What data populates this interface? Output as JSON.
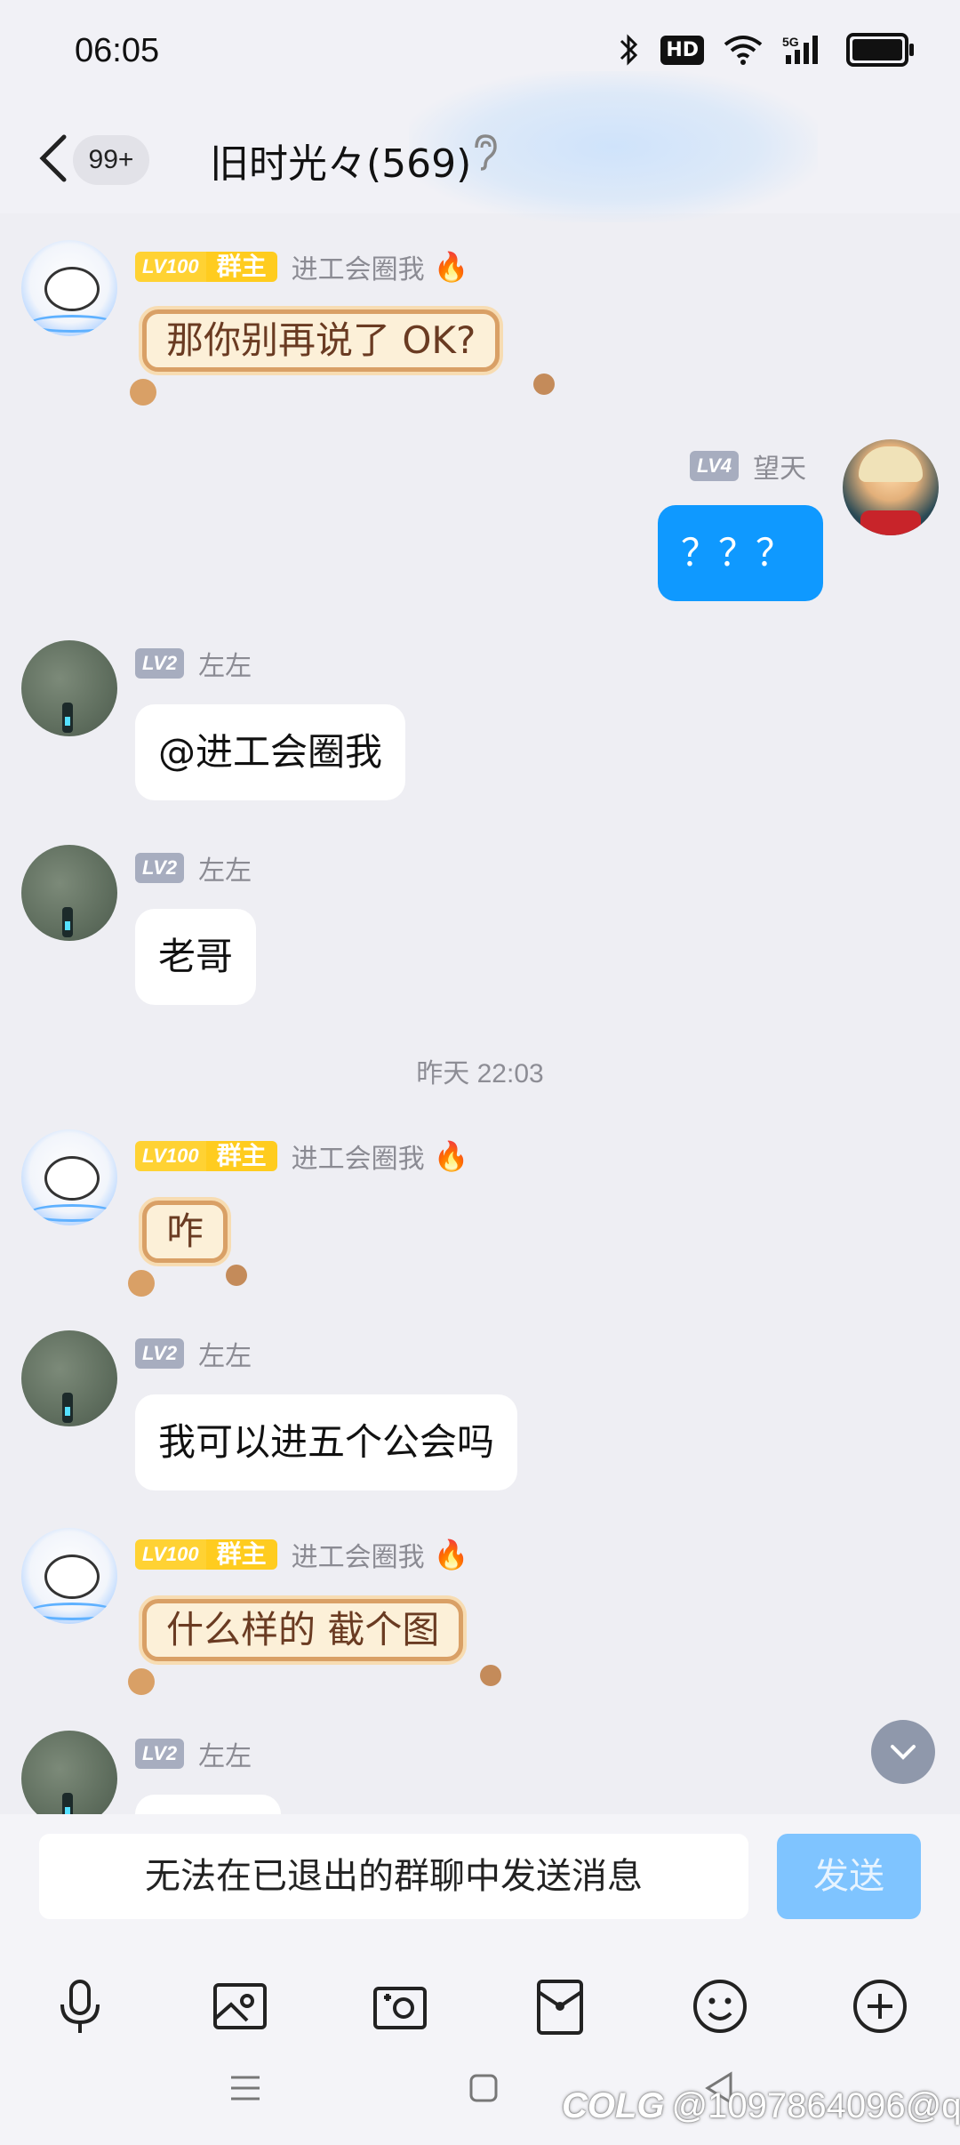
{
  "status_bar": {
    "time": "06:05",
    "hd": "HD",
    "network": "5G"
  },
  "header": {
    "unread_badge": "99+",
    "title": "旧时光々(569)",
    "back_icon": "chevron-left-icon",
    "ear_icon": "ear-icon"
  },
  "messages": [
    {
      "sender": "进工会圈我",
      "level": "LV100",
      "role": "群主",
      "text": "那你别再说了 OK?"
    },
    {
      "sender": "望天",
      "level": "LV4",
      "text": "？？？"
    },
    {
      "sender": "左左",
      "level": "LV2",
      "text": "@进工会圈我"
    },
    {
      "sender": "左左",
      "level": "LV2",
      "text": "老哥"
    },
    {
      "timestamp": "昨天 22:03"
    },
    {
      "sender": "进工会圈我",
      "level": "LV100",
      "role": "群主",
      "text": "咋"
    },
    {
      "sender": "左左",
      "level": "LV2",
      "text": "我可以进五个公会吗"
    },
    {
      "sender": "进工会圈我",
      "level": "LV100",
      "role": "群主",
      "text": "什么样的 截个图"
    },
    {
      "sender": "左左",
      "level": "LV2",
      "text": ""
    }
  ],
  "input": {
    "disabled_text": "无法在已退出的群聊中发送消息",
    "send_label": "发送"
  },
  "toolbar": [
    "microphone-icon",
    "image-icon",
    "camera-icon",
    "red-packet-icon",
    "emoji-icon",
    "plus-icon"
  ],
  "watermark": {
    "logo": "COLG",
    "text": "@1097864096@q"
  },
  "colors": {
    "accent": "#0f99ff",
    "gold": "#ffcc1f",
    "bear_border": "#d9a066"
  }
}
